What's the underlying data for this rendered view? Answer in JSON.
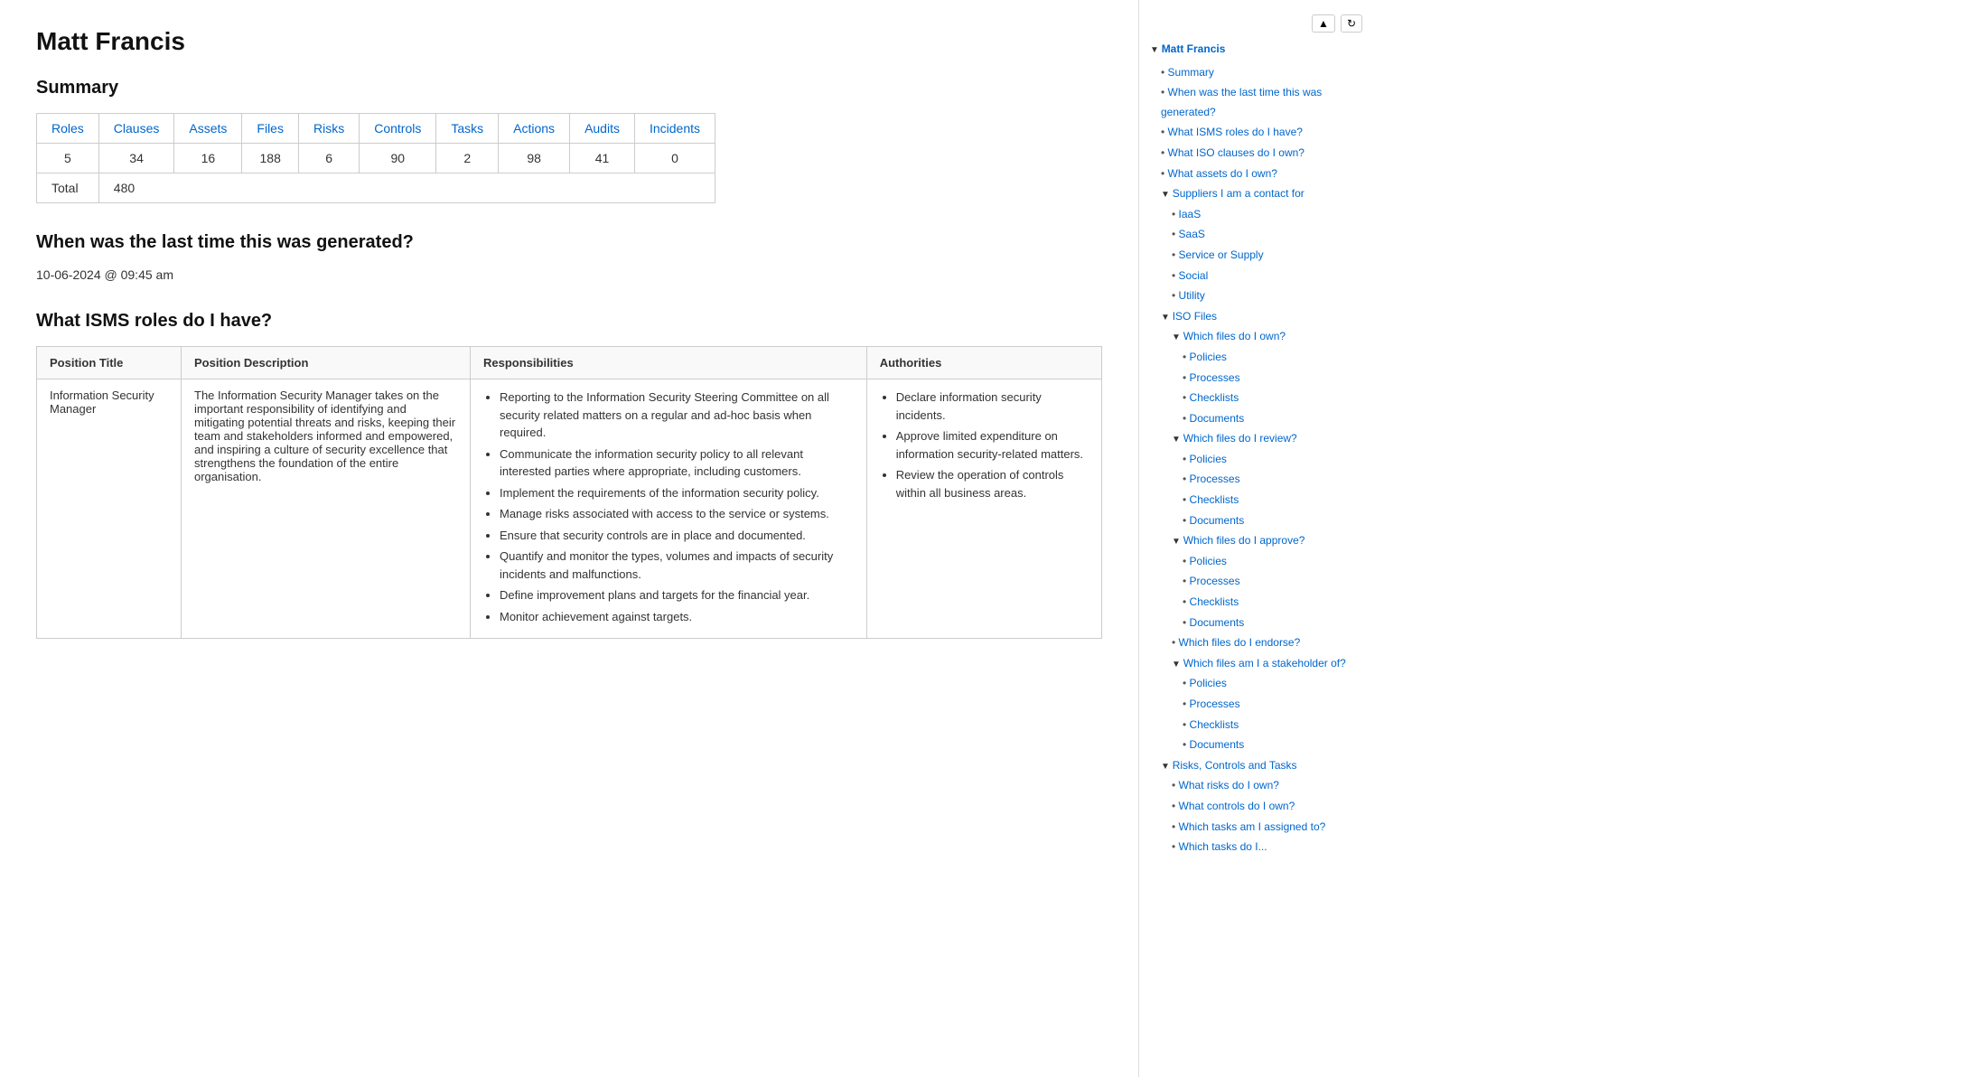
{
  "page": {
    "title": "Matt Francis"
  },
  "summary": {
    "heading": "Summary",
    "columns": [
      "Roles",
      "Clauses",
      "Assets",
      "Files",
      "Risks",
      "Controls",
      "Tasks",
      "Actions",
      "Audits",
      "Incidents"
    ],
    "values": [
      5,
      34,
      16,
      188,
      6,
      90,
      2,
      98,
      41,
      0
    ],
    "total_label": "Total",
    "total_value": "480"
  },
  "generated": {
    "heading": "When was the last time this was generated?",
    "date": "10-06-2024 @ 09:45 am"
  },
  "roles": {
    "heading": "What ISMS roles do I have?",
    "columns": [
      "Position Title",
      "Position Description",
      "Responsibilities",
      "Authorities"
    ],
    "rows": [
      {
        "position_title": "Information Security Manager",
        "position_description": "The Information Security Manager takes on the important responsibility of identifying and mitigating potential threats and risks, keeping their team and stakeholders informed and empowered, and inspiring a culture of security excellence that strengthens the foundation of the entire organisation.",
        "responsibilities": [
          "Reporting to the Information Security Steering Committee on all security related matters on a regular and ad-hoc basis when required.",
          "Communicate the information security policy to all relevant interested parties where appropriate, including customers.",
          "Implement the requirements of the information security policy.",
          "Manage risks associated with access to the service or systems.",
          "Ensure that security controls are in place and documented.",
          "Quantify and monitor the types, volumes and impacts of security incidents and malfunctions.",
          "Define improvement plans and targets for the financial year.",
          "Monitor achievement against targets."
        ],
        "authorities": [
          "Declare information security incidents.",
          "Approve limited expenditure on information security-related matters.",
          "Review the operation of controls within all business areas."
        ]
      }
    ]
  },
  "sidebar": {
    "root_label": "Matt Francis",
    "items": [
      {
        "label": "Summary",
        "level": 1,
        "type": "link"
      },
      {
        "label": "When was the last time this was generated?",
        "level": 1,
        "type": "link"
      },
      {
        "label": "What ISMS roles do I have?",
        "level": 1,
        "type": "link"
      },
      {
        "label": "What ISO clauses do I own?",
        "level": 1,
        "type": "link"
      },
      {
        "label": "What assets do I own?",
        "level": 1,
        "type": "link"
      },
      {
        "label": "Suppliers I am a contact for",
        "level": 1,
        "type": "collapsible"
      },
      {
        "label": "IaaS",
        "level": 2,
        "type": "link"
      },
      {
        "label": "SaaS",
        "level": 2,
        "type": "link"
      },
      {
        "label": "Service or Supply",
        "level": 2,
        "type": "link"
      },
      {
        "label": "Social",
        "level": 2,
        "type": "link"
      },
      {
        "label": "Utility",
        "level": 2,
        "type": "link"
      },
      {
        "label": "ISO Files",
        "level": 1,
        "type": "collapsible"
      },
      {
        "label": "Which files do I own?",
        "level": 2,
        "type": "collapsible"
      },
      {
        "label": "Policies",
        "level": 3,
        "type": "link"
      },
      {
        "label": "Processes",
        "level": 3,
        "type": "link"
      },
      {
        "label": "Checklists",
        "level": 3,
        "type": "link"
      },
      {
        "label": "Documents",
        "level": 3,
        "type": "link"
      },
      {
        "label": "Which files do I review?",
        "level": 2,
        "type": "collapsible"
      },
      {
        "label": "Policies",
        "level": 3,
        "type": "link"
      },
      {
        "label": "Processes",
        "level": 3,
        "type": "link"
      },
      {
        "label": "Checklists",
        "level": 3,
        "type": "link"
      },
      {
        "label": "Documents",
        "level": 3,
        "type": "link"
      },
      {
        "label": "Which files do I approve?",
        "level": 2,
        "type": "collapsible"
      },
      {
        "label": "Policies",
        "level": 3,
        "type": "link"
      },
      {
        "label": "Processes",
        "level": 3,
        "type": "link"
      },
      {
        "label": "Checklists",
        "level": 3,
        "type": "link"
      },
      {
        "label": "Documents",
        "level": 3,
        "type": "link"
      },
      {
        "label": "Which files do I endorse?",
        "level": 2,
        "type": "link"
      },
      {
        "label": "Which files am I a stakeholder of?",
        "level": 2,
        "type": "collapsible"
      },
      {
        "label": "Policies",
        "level": 3,
        "type": "link"
      },
      {
        "label": "Processes",
        "level": 3,
        "type": "link"
      },
      {
        "label": "Checklists",
        "level": 3,
        "type": "link"
      },
      {
        "label": "Documents",
        "level": 3,
        "type": "link"
      },
      {
        "label": "Risks, Controls and Tasks",
        "level": 1,
        "type": "collapsible"
      },
      {
        "label": "What risks do I own?",
        "level": 2,
        "type": "link"
      },
      {
        "label": "What controls do I own?",
        "level": 2,
        "type": "link"
      },
      {
        "label": "Which tasks am I assigned to?",
        "level": 2,
        "type": "link"
      },
      {
        "label": "Which tasks do I...",
        "level": 2,
        "type": "link"
      }
    ]
  },
  "sidebar_controls": {
    "collapse_icon": "▲",
    "refresh_icon": "↻"
  }
}
